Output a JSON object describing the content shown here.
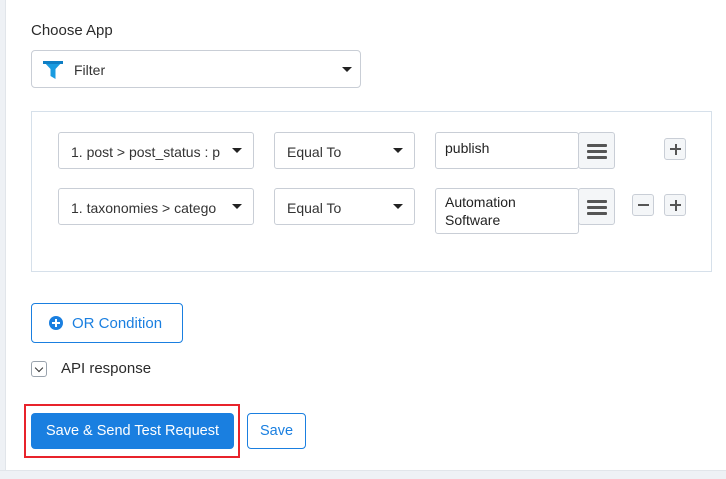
{
  "choose_app": {
    "label": "Choose App",
    "selected": "Filter",
    "icon": "funnel-icon",
    "icon_color": "#1a9be0"
  },
  "conditions": [
    {
      "field": "1. post > post_status : p",
      "operator": "Equal To",
      "value": "publish"
    },
    {
      "field": "1. taxonomies > catego",
      "operator": "Equal To",
      "value_line1": "Automation",
      "value_line2": "Software"
    }
  ],
  "or_condition": {
    "label": "OR Condition"
  },
  "api_response": {
    "label": "API response"
  },
  "actions": {
    "send_label": "Save & Send Test Request",
    "save_label": "Save"
  },
  "colors": {
    "primary": "#1a7fe0",
    "highlight": "#e8232b"
  }
}
